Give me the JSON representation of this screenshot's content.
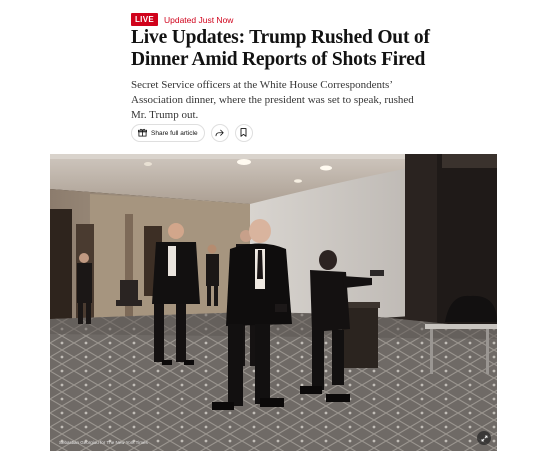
{
  "badge": {
    "label": "LIVE"
  },
  "status": {
    "updated": "Updated Just Now"
  },
  "headline": "Live Updates: Trump Rushed Out of Dinner Amid Reports of Shots Fired",
  "summary": "Secret Service officers at the White House Correspondents’ Association dinner, where the president was set to speak, rushed Mr. Trump out.",
  "actions": {
    "share_label": "Share full article",
    "share_icon": "gift-icon",
    "forward_icon": "share-arrow-icon",
    "save_icon": "bookmark-icon"
  },
  "photo": {
    "credit": "Sebastian Georgiou for The New York Times",
    "expand_icon": "expand-icon"
  },
  "colors": {
    "live": "#d0021b",
    "text": "#121212"
  }
}
